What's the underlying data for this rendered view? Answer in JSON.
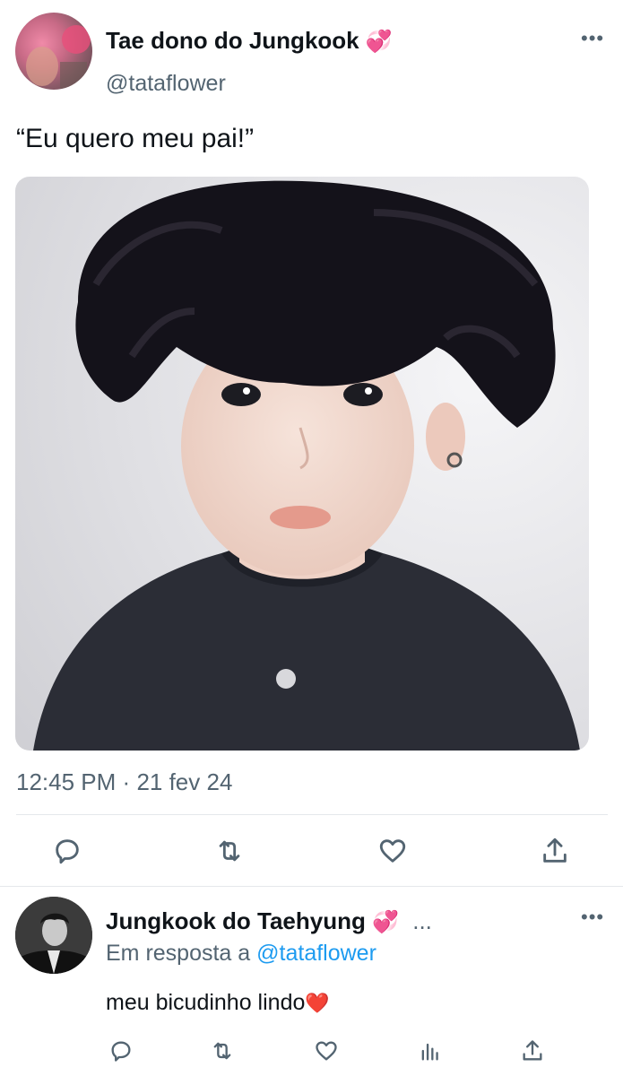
{
  "tweet": {
    "author_name": "Tae dono do Jungkook",
    "author_emoji": "💞",
    "author_handle": "@tataflower",
    "more_label": "•••",
    "text": "“Eu quero meu pai!”",
    "time": "12:45 PM",
    "separator": "·",
    "date": "21 fev 24",
    "actions": [
      "reply-icon",
      "retweet-icon",
      "like-icon",
      "share-icon"
    ]
  },
  "reply": {
    "author_name": "Jungkook do Taehyung",
    "author_emoji": "💞",
    "name_more": "...",
    "more_label": "•••",
    "reply_prefix": "Em resposta a",
    "reply_handle": "@tataflower",
    "text": "meu bicudinho lindo",
    "text_emoji": "❤️",
    "actions": [
      "reply-icon",
      "retweet-icon",
      "like-icon",
      "views-icon",
      "share-icon"
    ]
  },
  "colors": {
    "link": "#1d9bf0",
    "muted": "#536471",
    "text": "#0f1419"
  }
}
